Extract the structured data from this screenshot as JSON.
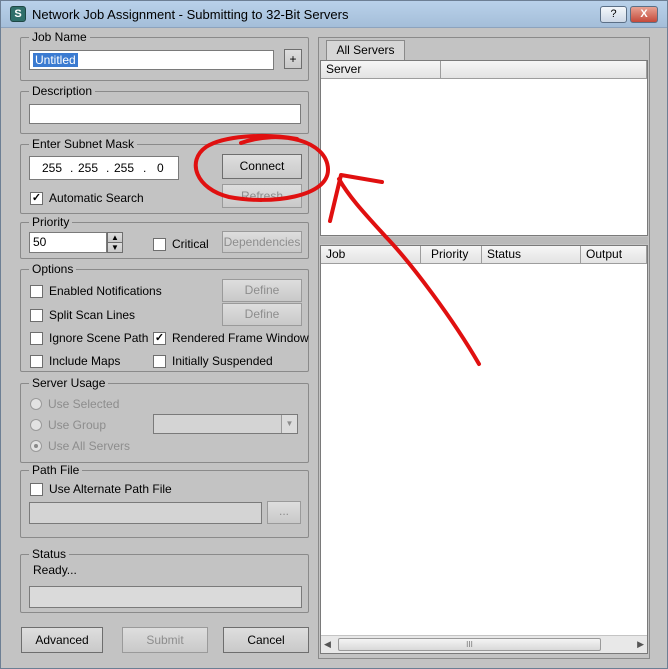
{
  "window": {
    "title": "Network Job Assignment - Submitting to 32-Bit Servers",
    "app_icon_glyph": "S",
    "help_glyph": "?",
    "close_glyph": "X"
  },
  "job_name": {
    "label": "Job Name",
    "value": "Untitled",
    "add_button": "+"
  },
  "description": {
    "label": "Description",
    "value": ""
  },
  "subnet": {
    "label": "Enter Subnet Mask",
    "octets": [
      "255",
      "255",
      "255",
      "0"
    ],
    "connect_button": "Connect",
    "refresh_button": "Refresh",
    "automatic_search": {
      "label": "Automatic Search",
      "checked": true
    }
  },
  "priority": {
    "label": "Priority",
    "value": "50",
    "critical": {
      "label": "Critical",
      "checked": false
    },
    "dependencies_button": "Dependencies"
  },
  "options": {
    "label": "Options",
    "enabled_notifications": {
      "label": "Enabled Notifications",
      "checked": false
    },
    "split_scan_lines": {
      "label": "Split Scan Lines",
      "checked": false
    },
    "ignore_scene_path": {
      "label": "Ignore Scene Path",
      "checked": false
    },
    "include_maps": {
      "label": "Include Maps",
      "checked": false
    },
    "rendered_frame_window": {
      "label": "Rendered Frame Window",
      "checked": true
    },
    "initially_suspended": {
      "label": "Initially Suspended",
      "checked": false
    },
    "define_button_1": "Define",
    "define_button_2": "Define"
  },
  "server_usage": {
    "label": "Server Usage",
    "use_selected": "Use Selected",
    "use_group": "Use Group",
    "use_all_servers": "Use All Servers",
    "selected_option": "Use All Servers"
  },
  "path_file": {
    "label": "Path File",
    "use_alternate": {
      "label": "Use Alternate Path File",
      "checked": false
    },
    "path_value": "",
    "browse_button": "..."
  },
  "status": {
    "label": "Status",
    "text": "Ready...",
    "field_value": ""
  },
  "footer": {
    "advanced": "Advanced",
    "submit": "Submit",
    "cancel": "Cancel"
  },
  "servers_panel": {
    "tab": "All Servers",
    "columns": [
      "Server",
      ""
    ]
  },
  "jobs_panel": {
    "columns": [
      "Job",
      "Priority",
      "Status",
      "Output"
    ],
    "scroll_grip": "III"
  },
  "annotation": {
    "color": "#e01010"
  }
}
